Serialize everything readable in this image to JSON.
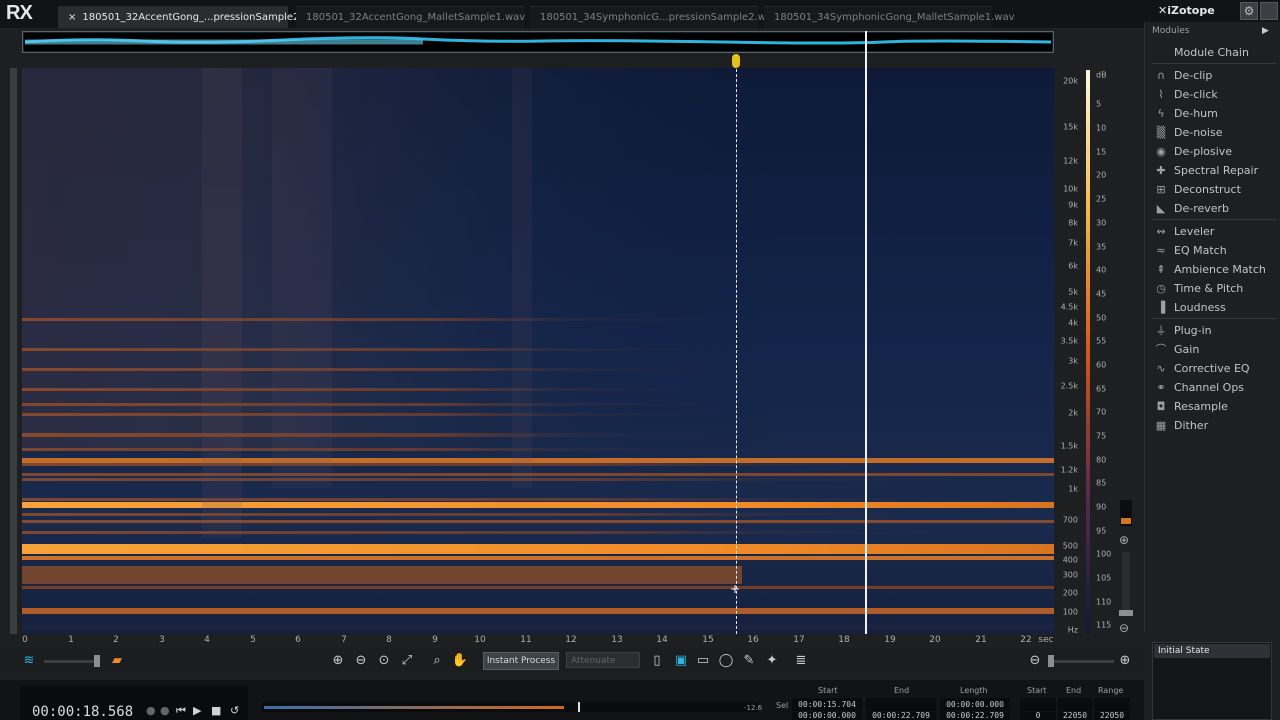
{
  "app": {
    "logo": "RX",
    "brand": "iZotope"
  },
  "tabs": [
    {
      "label": "180501_32AccentGong_...pressionSample2.wav",
      "active": true,
      "close": "×"
    },
    {
      "label": "180501_32AccentGong_MalletSample1.wav",
      "active": false
    },
    {
      "label": "180501_34SymphonicG...pressionSample2.wav",
      "active": false
    },
    {
      "label": "180501_34SymphonicGong_MalletSample1.wav",
      "active": false
    }
  ],
  "freq_axis": [
    "20k",
    "15k",
    "12k",
    "10k",
    "9k",
    "8k",
    "7k",
    "6k",
    "5k",
    "4.5k",
    "4k",
    "3.5k",
    "3k",
    "2.5k",
    "2k",
    "1.5k",
    "1.2k",
    "1k",
    "700",
    "500",
    "400",
    "300",
    "200",
    "100",
    "Hz"
  ],
  "db_axis": [
    "dB",
    "5",
    "10",
    "15",
    "20",
    "25",
    "30",
    "35",
    "40",
    "45",
    "50",
    "55",
    "60",
    "65",
    "70",
    "75",
    "80",
    "85",
    "90",
    "95",
    "100",
    "105",
    "110",
    "115"
  ],
  "time_axis": [
    "0",
    "1",
    "2",
    "3",
    "4",
    "5",
    "6",
    "7",
    "8",
    "9",
    "10",
    "11",
    "12",
    "13",
    "14",
    "15",
    "16",
    "17",
    "18",
    "19",
    "20",
    "21",
    "22",
    "sec"
  ],
  "toolbar": {
    "instant_process": "Instant Process",
    "attenuate": "Attenuate"
  },
  "modules": {
    "header": "Modules",
    "module_chain": "Module Chain",
    "group1": [
      {
        "label": "De-clip",
        "icon": "de-clip-icon"
      },
      {
        "label": "De-click",
        "icon": "de-click-icon"
      },
      {
        "label": "De-hum",
        "icon": "de-hum-icon"
      },
      {
        "label": "De-noise",
        "icon": "de-noise-icon"
      },
      {
        "label": "De-plosive",
        "icon": "de-plosive-icon"
      },
      {
        "label": "Spectral Repair",
        "icon": "spectral-repair-icon"
      },
      {
        "label": "Deconstruct",
        "icon": "deconstruct-icon"
      },
      {
        "label": "De-reverb",
        "icon": "de-reverb-icon"
      }
    ],
    "group2": [
      {
        "label": "Leveler",
        "icon": "leveler-icon"
      },
      {
        "label": "EQ Match",
        "icon": "eq-match-icon"
      },
      {
        "label": "Ambience Match",
        "icon": "ambience-match-icon"
      },
      {
        "label": "Time & Pitch",
        "icon": "time-pitch-icon"
      },
      {
        "label": "Loudness",
        "icon": "loudness-icon"
      }
    ],
    "group3": [
      {
        "label": "Plug-in",
        "icon": "plug-in-icon"
      },
      {
        "label": "Gain",
        "icon": "gain-icon"
      },
      {
        "label": "Corrective EQ",
        "icon": "corrective-eq-icon"
      },
      {
        "label": "Channel Ops",
        "icon": "channel-ops-icon"
      },
      {
        "label": "Resample",
        "icon": "resample-icon"
      },
      {
        "label": "Dither",
        "icon": "dither-icon"
      }
    ]
  },
  "history": {
    "item": "Initial State"
  },
  "transport": {
    "timecode": "00:00:18.568",
    "meter_label": "-12.6"
  },
  "selection": {
    "headers": {
      "start": "Start",
      "end": "End",
      "length": "Length",
      "start2": "Start",
      "end2": "End",
      "range": "Range"
    },
    "sel_label": "Sel",
    "sel_start": "00:00:15.704",
    "view_start": "00:00:00.000",
    "view_end": "00:00:22.709",
    "sel_length": "00:00:00.000",
    "view_length": "00:00:22.709",
    "freq_start": "0",
    "freq_end": "22050",
    "freq_range": "22050"
  },
  "colors": {
    "accent": "#2fb4e0",
    "marker": "#e3c21d",
    "spectrum_hot": "#f5a030",
    "spectrum_bg": "#0f1c3d"
  }
}
